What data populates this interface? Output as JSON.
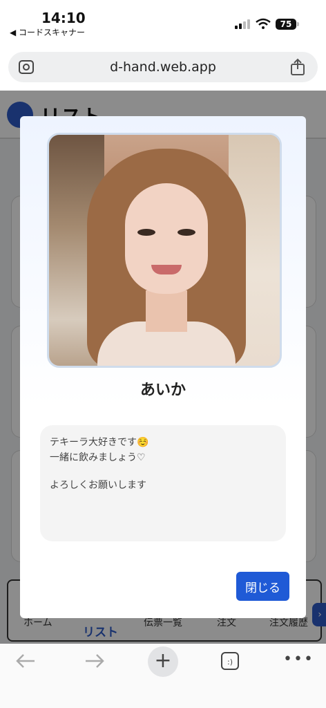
{
  "status_bar": {
    "time": "14:10",
    "back_app": "◀ コードスキャナー",
    "battery": "75"
  },
  "browser": {
    "url": "d-hand.web.app"
  },
  "app": {
    "title": "リスト",
    "nav": {
      "home": "ホーム",
      "list": "リスト",
      "slips": "伝票一覧",
      "order": "注文",
      "history": "注文履歴"
    }
  },
  "modal": {
    "name": "あいか",
    "message_line1": "テキーラ大好きです☺️",
    "message_line2": "一緒に飲みましょう♡",
    "message_line3": "よろしくお願いします",
    "close_label": "閉じる"
  },
  "toolbar": {
    "tabs_label": ":)",
    "more_label": "•••"
  },
  "colors": {
    "accent": "#1f5ad6",
    "overlay": "rgba(0,0,0,0.45)"
  }
}
